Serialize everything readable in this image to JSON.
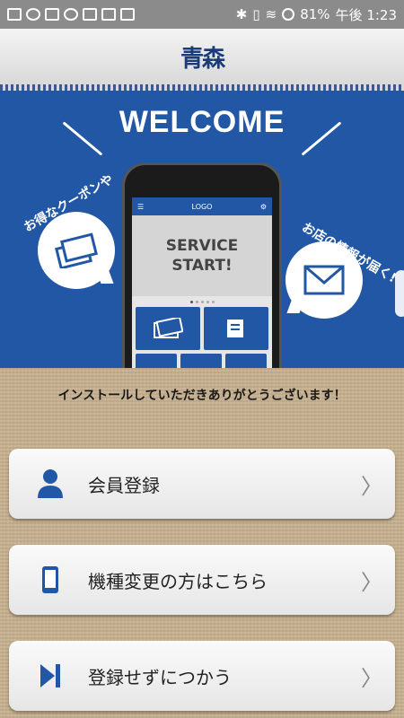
{
  "status_bar": {
    "battery": "81%",
    "time": "午後 1:23"
  },
  "header": {
    "logo_text": "青森"
  },
  "banner": {
    "title": "WELCOME",
    "phone_logo": "LOGO",
    "hero_line1": "SERVICE",
    "hero_line2": "START!",
    "left_caption": "お得なクーポンや",
    "right_caption": "お店の情報が届く!"
  },
  "message": "インストールしていただきありがとうございます！",
  "buttons": [
    {
      "label": "会員登録",
      "icon": "person-icon"
    },
    {
      "label": "機種変更の方はこちら",
      "icon": "smartphone-icon"
    },
    {
      "label": "登録せずにつかう",
      "icon": "skip-icon"
    }
  ],
  "colors": {
    "brand_blue": "#2257a6",
    "status_bar": "#8b8b8b",
    "burlap": "#c7b190"
  }
}
